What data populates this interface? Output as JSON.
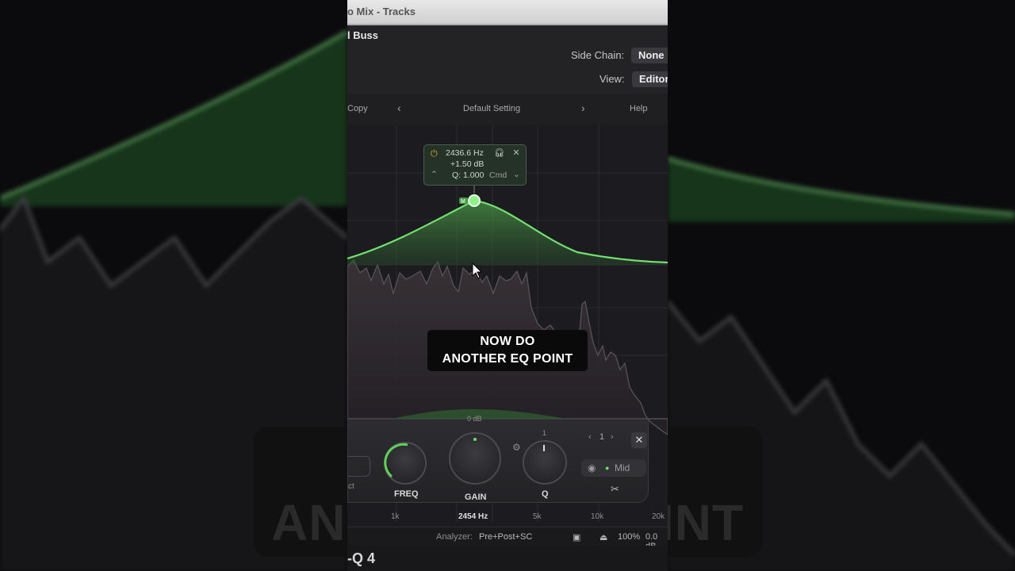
{
  "window": {
    "title": "o Mix - Tracks"
  },
  "header": {
    "track_name": "l Buss",
    "side_chain_label": "Side Chain:",
    "side_chain_value": "None",
    "view_label": "View:",
    "view_value": "Editor"
  },
  "toolbar": {
    "copy": "Copy",
    "prev": "‹",
    "preset": "Default Setting",
    "next": "›",
    "help": "Help"
  },
  "tooltip": {
    "freq": "2436.6 Hz",
    "gain": "+1.50 dB",
    "q": "Q: 1.000",
    "mod": "Cmd"
  },
  "band_marker": "M",
  "caption": {
    "line1": "NOW DO",
    "line2": "ANOTHER EQ POINT"
  },
  "band_panel": {
    "gain_top": "0 dB",
    "q_top": "1",
    "band_nav": "1",
    "left_text": "ct",
    "freq_label": "FREQ",
    "gain_label": "GAIN",
    "q_label": "Q",
    "mode": "Mid"
  },
  "freq_axis": {
    "t1k": "1k",
    "cursor": "2454 Hz",
    "t5k": "5k",
    "t10k": "10k",
    "t20k": "20k"
  },
  "statusbar": {
    "analyzer_label": "Analyzer:",
    "analyzer_value": "Pre+Post+SC",
    "zoom": "100%",
    "gain": "0.0 dB"
  },
  "footer": {
    "product": "-Q 4"
  },
  "background_caption": {
    "left": "AN",
    "right": "INT"
  },
  "colors": {
    "accent": "#6ee06a",
    "background": "#1c1b1f",
    "tooltip_power": "#e2a93a"
  }
}
